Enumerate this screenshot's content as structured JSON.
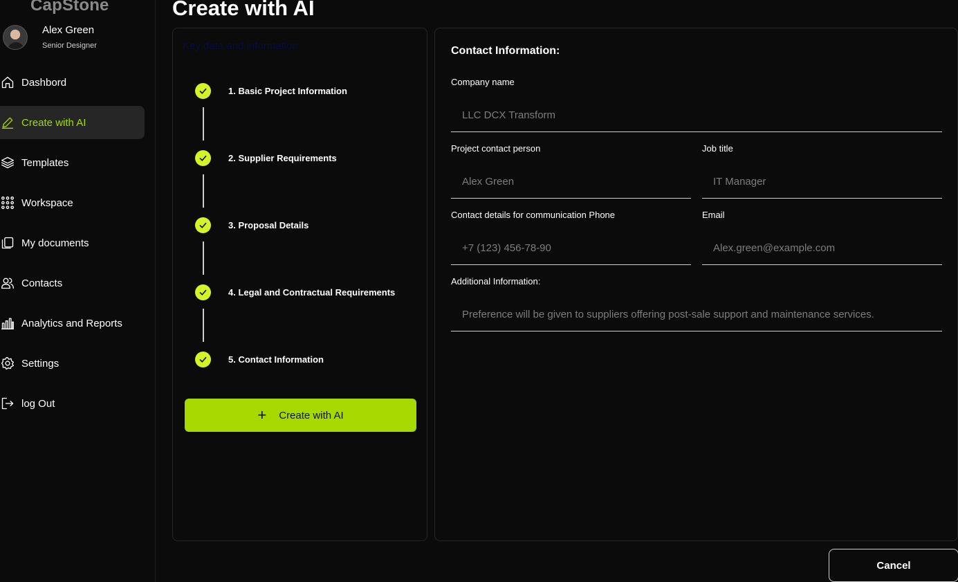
{
  "brand": {
    "name": "CapStone"
  },
  "user": {
    "name": "Alex Green",
    "role": "Senior Designer"
  },
  "nav": {
    "items": [
      {
        "label": "Dashbord",
        "icon": "home-icon"
      },
      {
        "label": "Create with AI",
        "icon": "pencil-icon",
        "active": true
      },
      {
        "label": "Templates",
        "icon": "layers-icon"
      },
      {
        "label": "Workspace",
        "icon": "grid-dots-icon"
      },
      {
        "label": "My documents",
        "icon": "documents-icon"
      },
      {
        "label": "Contacts",
        "icon": "users-icon"
      },
      {
        "label": "Analytics and Reports",
        "icon": "bar-chart-icon"
      },
      {
        "label": "Settings",
        "icon": "gear-icon"
      },
      {
        "label": "log Out",
        "icon": "logout-icon"
      }
    ]
  },
  "page": {
    "title": "Create with AI"
  },
  "steps": {
    "heading": "Key data and information",
    "items": [
      {
        "label": "1. Basic Project Information",
        "done": true
      },
      {
        "label": "2. Supplier Requirements",
        "done": true
      },
      {
        "label": "3. Proposal Details",
        "done": true
      },
      {
        "label": "4. Legal and Contractual Requirements",
        "done": true
      },
      {
        "label": "5. Contact Information",
        "done": true
      }
    ],
    "create_label": "Create with AI"
  },
  "form": {
    "title": "Contact Information:",
    "company": {
      "label": "Company name",
      "placeholder": "LLC DCX Transform"
    },
    "contact_person": {
      "label": "Project contact person",
      "placeholder": "Alex Green"
    },
    "job_title": {
      "label": "Job title",
      "placeholder": "IT Manager"
    },
    "phone": {
      "label": "Contact details for communication Phone",
      "placeholder": "+7 (123) 456-78-90"
    },
    "email": {
      "label": "Email",
      "placeholder": "Alex.green@example.com"
    },
    "additional": {
      "label": "Additional Information:",
      "placeholder": "Preference will be given to suppliers offering post-sale support and maintenance services."
    }
  },
  "actions": {
    "cancel_label": "Cancel"
  },
  "colors": {
    "accent": "#a5d900",
    "check": "#d4f427",
    "background": "#0b0b0b"
  }
}
